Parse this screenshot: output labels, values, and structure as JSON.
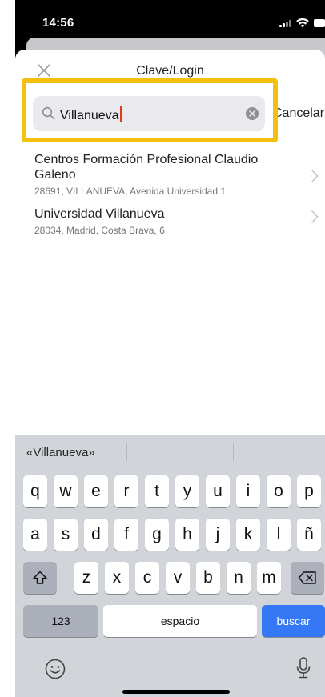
{
  "status_bar": {
    "time": "14:56"
  },
  "sheet": {
    "title": "Clave/Login"
  },
  "search": {
    "value": "Villanueva",
    "cancel_label": "Cancelar"
  },
  "results": [
    {
      "name": "Centros Formación Profesional Claudio Galeno",
      "address": "28691, VILLANUEVA, Avenida Universidad 1"
    },
    {
      "name": "Universidad Villanueva",
      "address": "28034, Madrid, Costa Brava, 6"
    }
  ],
  "keyboard": {
    "suggestion": "«Villanueva»",
    "row1": [
      "q",
      "w",
      "e",
      "r",
      "t",
      "y",
      "u",
      "i",
      "o",
      "p"
    ],
    "row2": [
      "a",
      "s",
      "d",
      "f",
      "g",
      "h",
      "j",
      "k",
      "l",
      "ñ"
    ],
    "row3": [
      "z",
      "x",
      "c",
      "v",
      "b",
      "n",
      "m"
    ],
    "numbers_key": "123",
    "space_key": "espacio",
    "action_key": "buscar"
  },
  "colors": {
    "highlight": "#f5bf0e",
    "action_key": "#3478f6",
    "caret": "#e53a1d"
  }
}
